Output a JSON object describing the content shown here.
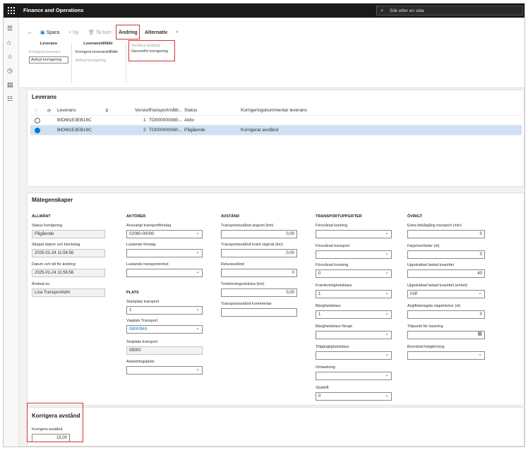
{
  "app": {
    "title": "Finance and Operations",
    "search_placeholder": "Sök efter en sida"
  },
  "toolbar": {
    "save": "Spara",
    "new": "Ny",
    "delete": "Ta bort",
    "change_tab": "Ändring",
    "options_tab": "Alternativ"
  },
  "ribbon": {
    "group1": {
      "title": "Leverans",
      "items": [
        "Korrigera leverans",
        "Avbryt korrigering"
      ]
    },
    "group2": {
      "title": "Leveranstillfälle",
      "items": [
        "Korrigera leveranstillfälle",
        "Avbryt korrigering"
      ]
    },
    "flyout": [
      "Verifiera ändring",
      "Genomför korrigering"
    ]
  },
  "leverans": {
    "title": "Leverans",
    "columns": [
      "Leverans",
      "Version",
      "Transportmåtti...",
      "Status",
      "Korrigeringskommentar leverans"
    ],
    "rows": [
      {
        "leverans": "BIOM1E3EB19C",
        "version": "1",
        "transport": "TO000000080...",
        "status": "Aktiv",
        "comment": ""
      },
      {
        "leverans": "BIOM1E3EB19C",
        "version": "2",
        "transport": "TO000000080...",
        "status": "Pågående",
        "comment": "Korrigerat avstånd"
      }
    ]
  },
  "props": {
    "title": "Mätegenskaper",
    "allmant": {
      "title": "ALLMÄNT",
      "status_label": "Status korrigering",
      "status": "Pågående",
      "created_label": "Skapat datum och klockslag",
      "created": "2025-01-24 11:56:56",
      "changed_label": "Datum och tid för ändring",
      "changed": "2025-01-24 11:56:56",
      "changed_by_label": "Ändrad av",
      "changed_by": "Lisa.TransportAdm"
    },
    "aktorer": {
      "title": "AKTÖRER",
      "resp_label": "Ansvarigt transportföretag",
      "resp": "02080-00000",
      "load_label": "Lastande företag",
      "load": "",
      "unit_label": "Lastande transportenhet",
      "unit": ""
    },
    "plats": {
      "title": "PLATS",
      "start_label": "Startplats transport",
      "start": "1",
      "via_label": "Viaplats Transport",
      "via": "08000MA",
      "end_label": "Slutplats transport",
      "end": "08000",
      "unload_label": "Avlastningsplats",
      "unload": ""
    },
    "avstand": {
      "title": "AVSTÅND",
      "given_label": "Transportavstånd angivet (km)",
      "given": "0,00",
      "road_label": "Transportavstånd kränt väg/väl (km)",
      "road": "0,00",
      "ret_label": "Returavstånd",
      "ret": "0",
      "empty_label": "Tomkörningssträcka (km)",
      "empty": "0,00",
      "comment_label": "Transportavstånd kommentar",
      "comment": ""
    },
    "uppgifter": {
      "title": "TRANSPORTUPPGIFTER",
      "f1_label": "Försvårad lastning",
      "f1": "",
      "f2_label": "Försvårad transport",
      "f2": "",
      "f3_label": "Försvårad lossning",
      "f3": "0",
      "f4_label": "Framkomlighetsklass",
      "f4": "1",
      "f5_label": "Bärighetsklass",
      "f5": "1",
      "f6_label": "Bärighetsklass Norge",
      "f6": "",
      "f7_label": "Tillgänglighetsklass",
      "f7": "",
      "f8_label": "Omlastning",
      "f8": "",
      "f9_label": "Slutdrift",
      "f9": "0"
    },
    "ovrigt": {
      "title": "ÖVRIGT",
      "o1_label": "Extra tidsåtgång transport (min)",
      "o1": "0",
      "o2_label": "Färjeöverfarter (st)",
      "o2": "0",
      "o3_label": "Uppskattad lastad kvantitet",
      "o3": "40",
      "o4_label": "Uppskattad lastad kvantitet (enhet)",
      "o4": "m3f",
      "o5_label": "Avgiftsbelagda vägsträckor (st)",
      "o5": "0",
      "o6_label": "Tidpunkt för lossning",
      "o6": "",
      "o7_label": "Beordrad helgkörning",
      "o7": ""
    }
  },
  "korr": {
    "title": "Korrigera avstånd",
    "label": "Korrigera avstånd",
    "value": "15,00"
  }
}
